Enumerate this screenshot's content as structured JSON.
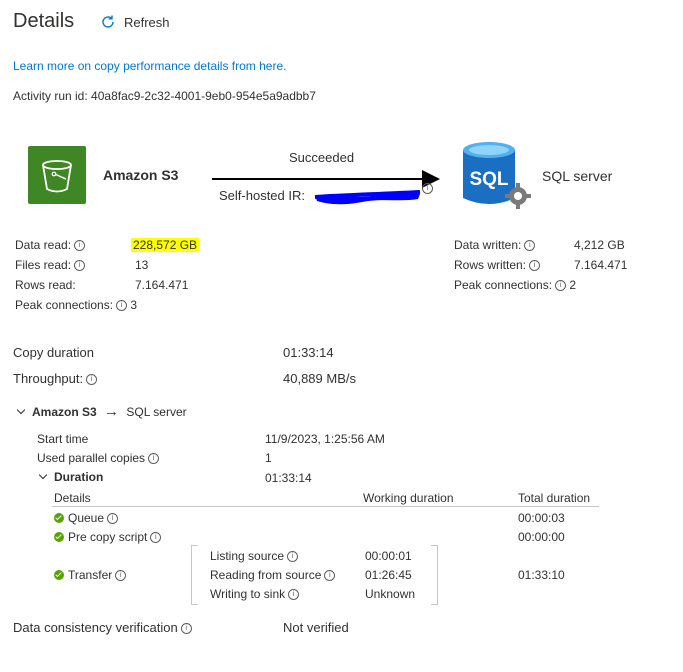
{
  "header": {
    "title": "Details",
    "refresh_label": "Refresh"
  },
  "learn_more_link": "Learn more on copy performance details from here.",
  "activity_run": {
    "label": "Activity run id:",
    "value": "40a8fac9-2c32-4001-9eb0-954e5a9adbb7"
  },
  "flow": {
    "source_name": "Amazon S3",
    "sink_name": "SQL server",
    "status": "Succeeded",
    "ir_label": "Self-hosted IR:",
    "ir_icon": "info-icon",
    "sink_icon_text": "SQL",
    "colors": {
      "success": "#57a300",
      "s3": "#3f8624",
      "sql": "#1b6fc2",
      "redaction": "#0000ff",
      "highlight": "#ffff00"
    }
  },
  "source_stats": {
    "data_read_label": "Data read:",
    "data_read_value": "228,572 GB",
    "files_read_label": "Files read:",
    "files_read_value": "13",
    "rows_read_label": "Rows read:",
    "rows_read_value": "7.164.471",
    "peak_connections_label": "Peak connections:",
    "peak_connections_value": "3"
  },
  "sink_stats": {
    "data_written_label": "Data written:",
    "data_written_value": "4,212 GB",
    "rows_written_label": "Rows written:",
    "rows_written_value": "7.164.471",
    "peak_connections_label": "Peak connections:",
    "peak_connections_value": "2"
  },
  "summary": {
    "copy_duration_label": "Copy duration",
    "copy_duration_value": "01:33:14",
    "throughput_label": "Throughput:",
    "throughput_value": "40,889 MB/s"
  },
  "pair": {
    "source": "Amazon S3",
    "arrow": "→",
    "sink": "SQL server",
    "start_time_label": "Start time",
    "start_time_value": "11/9/2023, 1:25:56 AM",
    "parallel_label": "Used parallel copies",
    "parallel_value": "1",
    "duration_label": "Duration",
    "duration_value": "01:33:14"
  },
  "table": {
    "headers": {
      "details": "Details",
      "working": "Working duration",
      "total": "Total duration"
    },
    "queue": {
      "label": "Queue",
      "total": "00:00:03"
    },
    "pre_copy": {
      "label": "Pre copy script",
      "total": "00:00:00"
    },
    "transfer": {
      "label": "Transfer",
      "total": "01:33:10",
      "steps": [
        {
          "label": "Listing source",
          "value": "00:00:01"
        },
        {
          "label": "Reading from source",
          "value": "01:26:45"
        },
        {
          "label": "Writing to sink",
          "value": "Unknown"
        }
      ]
    }
  },
  "verification": {
    "label": "Data consistency verification",
    "value": "Not verified"
  }
}
